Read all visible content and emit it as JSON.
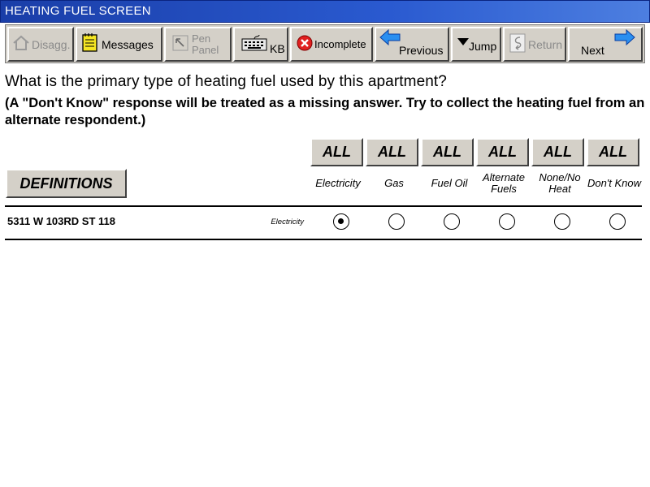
{
  "window": {
    "title": "HEATING FUEL SCREEN"
  },
  "toolbar": {
    "disagg": "Disagg.",
    "messages": "Messages",
    "pen_panel": "Pen Panel",
    "kb": "KB",
    "incomplete": "Incomplete",
    "previous": "Previous",
    "jump": "Jump",
    "return": "Return",
    "next": "Next"
  },
  "question": {
    "text": "What is the primary type of heating fuel used by this apartment?",
    "note": "(A \"Don't Know\" response will be treated as a missing answer. Try to collect the heating fuel from an alternate respondent.)"
  },
  "all_label": "ALL",
  "definitions_label": "DEFINITIONS",
  "columns": [
    "Electricity",
    "Gas",
    "Fuel Oil",
    "Alternate Fuels",
    "None/No Heat",
    "Don't Know"
  ],
  "row": {
    "address": "5311 W 103RD ST 118",
    "current_answer": "Electricity",
    "selected_index": 0
  },
  "colors": {
    "titlebar": "#1a3ea8",
    "button_face": "#d4d0c8",
    "incomplete_icon": "#e02020",
    "arrow_blue": "#2a8ff0",
    "messages_icon": "#f5e623"
  }
}
